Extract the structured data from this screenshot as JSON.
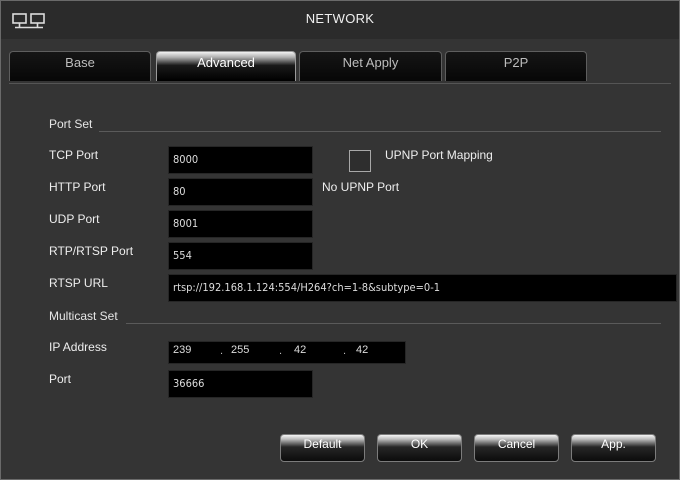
{
  "window": {
    "title": "NETWORK",
    "icon": "network-icon"
  },
  "tabs": [
    {
      "label": "Base",
      "active": false
    },
    {
      "label": "Advanced",
      "active": true
    },
    {
      "label": "Net Apply",
      "active": false
    },
    {
      "label": "P2P",
      "active": false
    }
  ],
  "port_set": {
    "heading": "Port Set",
    "tcp": {
      "label": "TCP Port",
      "value": "8000"
    },
    "http": {
      "label": "HTTP Port",
      "value": "80"
    },
    "udp": {
      "label": "UDP Port",
      "value": "8001"
    },
    "rtp": {
      "label": "RTP/RTSP Port",
      "value": "554"
    },
    "rtsp_url": {
      "label": "RTSP URL",
      "value": "rtsp://192.168.1.124:554/H264?ch=1-8&subtype=0-1"
    },
    "upnp": {
      "label": "UPNP Port Mapping",
      "checked": false,
      "status": "No UPNP Port"
    }
  },
  "multicast_set": {
    "heading": "Multicast Set",
    "ip": {
      "label": "IP Address",
      "octets": [
        "239",
        "255",
        "42",
        "42"
      ]
    },
    "port": {
      "label": "Port",
      "value": "36666"
    }
  },
  "buttons": {
    "default": "Default",
    "ok": "OK",
    "cancel": "Cancel",
    "apply": "App."
  },
  "colors": {
    "panel": "#343434",
    "field": "#000000",
    "titlebar": "#2b2b2b"
  }
}
